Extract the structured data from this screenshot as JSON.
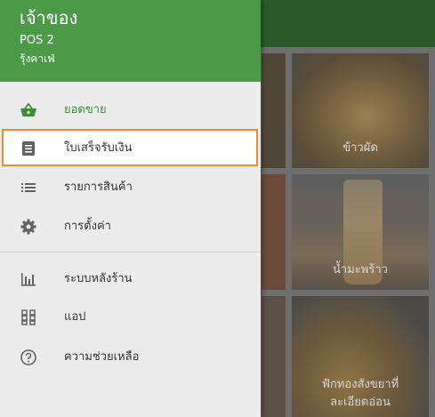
{
  "drawer": {
    "header": {
      "owner": "เจ้าของ",
      "pos_name": "POS 2",
      "shop_name": "รุ้งคาเฟ่"
    },
    "menu": {
      "sales": {
        "label": "ยอดขาย",
        "icon": "basket-icon"
      },
      "receipt": {
        "label": "ใบเสร็จรับเงิน",
        "icon": "receipt-icon"
      },
      "products": {
        "label": "รายการสินค้า",
        "icon": "list-icon"
      },
      "settings": {
        "label": "การตั้งค่า",
        "icon": "gear-icon"
      },
      "reports": {
        "label": "ระบบหลังร้าน",
        "icon": "bar-chart-icon"
      },
      "apps": {
        "label": "แอป",
        "icon": "apps-icon"
      },
      "help": {
        "label": "ความช่วยเหลือ",
        "icon": "help-icon"
      }
    }
  },
  "background": {
    "tiles": [
      {
        "label": "ข้าวผัด"
      },
      {
        "label": "น้ำมะพร้าว"
      },
      {
        "label_line1": "ฟักทองสังขยาที่",
        "label_line2": "ละเอียดอ่อน"
      }
    ]
  },
  "colors": {
    "header_green": "#4a9a48",
    "active_green": "#3f8c3c",
    "highlight_orange": "#ef8a2e",
    "drawer_bg": "#ececec"
  }
}
